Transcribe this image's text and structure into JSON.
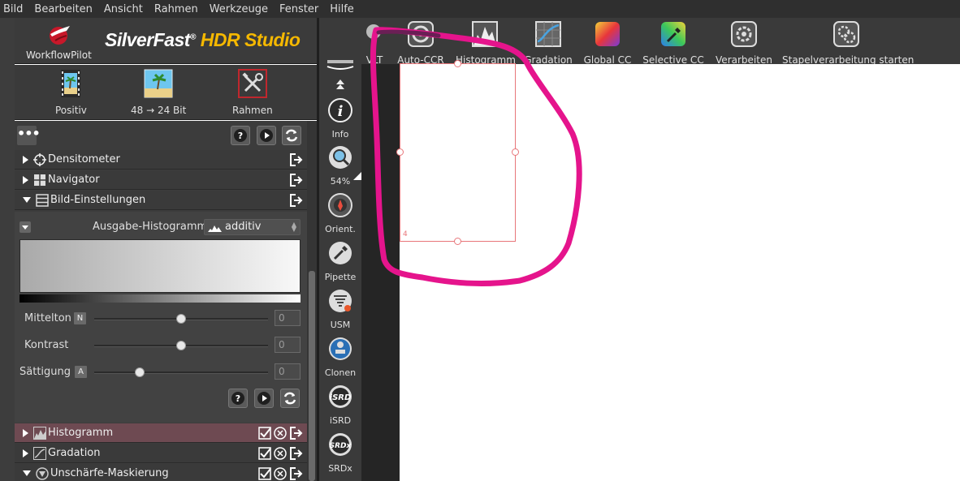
{
  "menu": [
    "Bild",
    "Bearbeiten",
    "Ansicht",
    "Rahmen",
    "Werkzeuge",
    "Fenster",
    "Hilfe"
  ],
  "header": {
    "workflow_label": "WorkflowPilot",
    "brand_main": "SilverFast",
    "brand_reg": "®",
    "brand_sub": "HDR Studio"
  },
  "quickbar": [
    {
      "label": "Positiv",
      "icon": "film-palm-icon"
    },
    {
      "label": "48 → 24 Bit",
      "icon": "palm-image-icon"
    },
    {
      "label": "Rahmen",
      "icon": "tools-icon"
    }
  ],
  "panel": {
    "dots_label": "•••",
    "sections_top": [
      {
        "title": "Densitometer",
        "icon": "crosshair-icon",
        "expanded": false
      },
      {
        "title": "Navigator",
        "icon": "grid-icon",
        "expanded": false
      },
      {
        "title": "Bild-Einstellungen",
        "icon": "list-icon",
        "expanded": true
      }
    ],
    "bild": {
      "output_hist_label": "Ausgabe-Histogramm",
      "output_hist_value": "additiv",
      "sliders": [
        {
          "label": "Mittelton",
          "badge": "N",
          "value": "0",
          "pos": 0.5
        },
        {
          "label": "Kontrast",
          "badge": "",
          "value": "0",
          "pos": 0.5
        },
        {
          "label": "Sättigung",
          "badge": "A",
          "value": "0",
          "pos": 0.26
        }
      ]
    },
    "sections_bottom": [
      {
        "title": "Histogramm",
        "icon": "histogram-icon",
        "expanded": false,
        "highlight": true
      },
      {
        "title": "Gradation",
        "icon": "gradation-icon",
        "expanded": false,
        "highlight": false
      },
      {
        "title": "Unschärfe-Maskierung",
        "icon": "usm-icon",
        "expanded": true,
        "highlight": false
      }
    ]
  },
  "tools": [
    {
      "label": "Info",
      "icon": "info-icon"
    },
    {
      "label": "54%",
      "icon": "zoom-icon"
    },
    {
      "label": "Orient.",
      "icon": "compass-icon"
    },
    {
      "label": "Pipette",
      "icon": "pipette-icon"
    },
    {
      "label": "USM",
      "icon": "usm-icon"
    },
    {
      "label": "Clonen",
      "icon": "clone-stamp-icon"
    },
    {
      "label": "iSRD",
      "icon": "isrd-icon"
    },
    {
      "label": "SRDx",
      "icon": "srdx-icon"
    }
  ],
  "toolbar": [
    {
      "label": "VLT",
      "icon": "vlt-icon"
    },
    {
      "label": "Auto-CCR",
      "icon": "auto-ccr-icon"
    },
    {
      "label": "Histogramm",
      "icon": "histogram-icon"
    },
    {
      "label": "Gradation",
      "icon": "gradation-icon"
    },
    {
      "label": "Global CC",
      "icon": "global-cc-icon"
    },
    {
      "label": "Selective CC",
      "icon": "selective-cc-icon"
    },
    {
      "label": "Verarbeiten",
      "icon": "process-icon"
    },
    {
      "label": "Stapelverarbeitung starten",
      "icon": "batch-icon"
    }
  ],
  "frame_number": "4",
  "colors": {
    "annotation": "#e5148c",
    "frame": "#e8767a",
    "brand_accent": "#f5b800",
    "highlight_row": "#6e4a52"
  }
}
